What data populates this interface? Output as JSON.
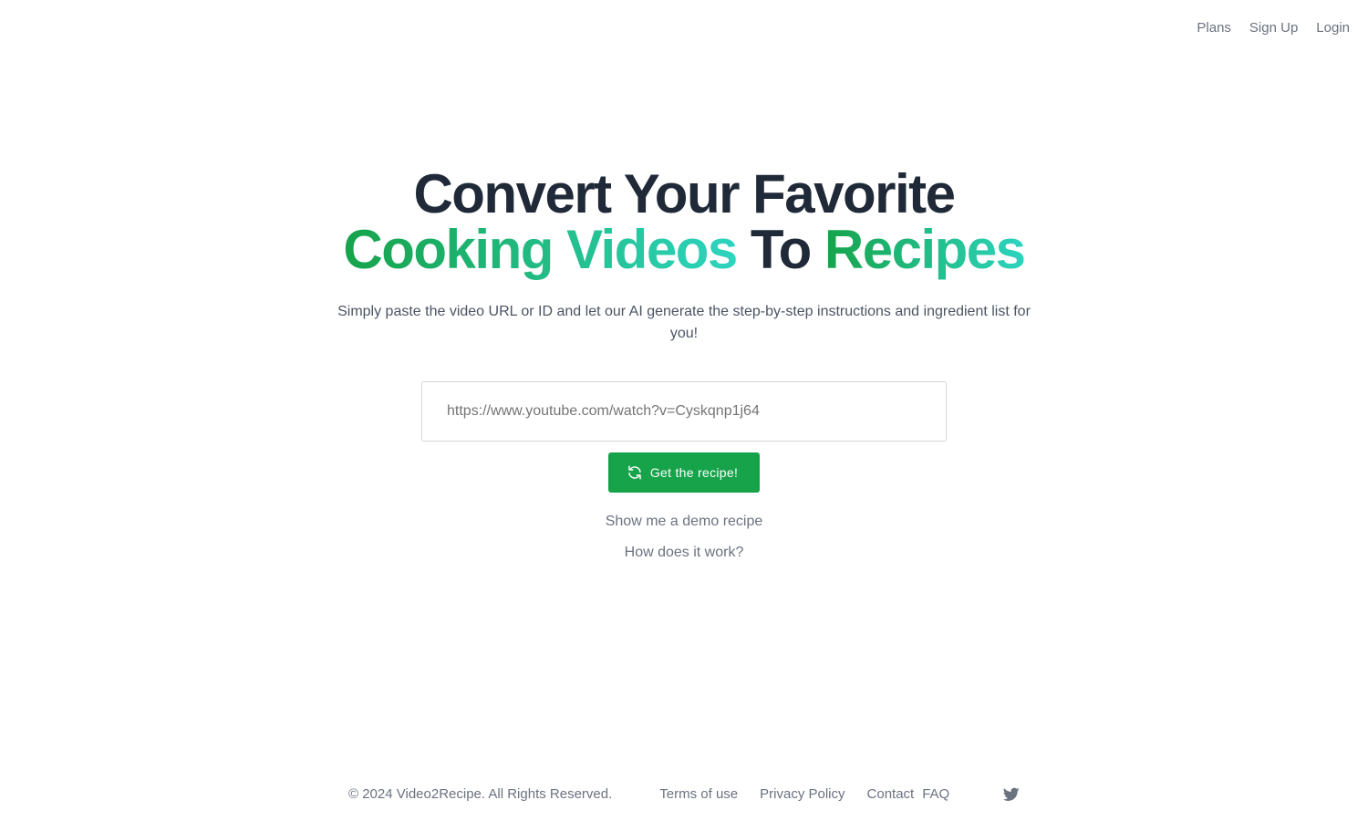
{
  "nav": {
    "items": [
      {
        "label": "Plans"
      },
      {
        "label": "Sign Up"
      },
      {
        "label": "Login"
      }
    ]
  },
  "hero": {
    "line1": "Convert Your Favorite",
    "line2_part1": "Cooking Videos",
    "line2_part2": "To",
    "line2_part3": "Recipes",
    "subtitle": "Simply paste the video URL or ID and let our AI generate the step-by-step instructions and ingredient list for you!",
    "input_value": "",
    "input_placeholder": "https://www.youtube.com/watch?v=Cyskqnp1j64",
    "button_label": "Get the recipe!",
    "button_icon": "refresh-icon",
    "demo_link": "Show me a demo recipe",
    "how_link": "How does it work?"
  },
  "footer": {
    "copyright": "© 2024 Video2Recipe. All Rights Reserved.",
    "links": [
      {
        "label": "Terms of use"
      },
      {
        "label": "Privacy Policy"
      },
      {
        "label": "Contact"
      },
      {
        "label": "FAQ"
      }
    ],
    "social_icon": "twitter-icon"
  },
  "colors": {
    "brand_green": "#16a34a",
    "gradient_end": "#2dd4bf",
    "heading_dark": "#1f2937",
    "muted_text": "#6b7280"
  }
}
